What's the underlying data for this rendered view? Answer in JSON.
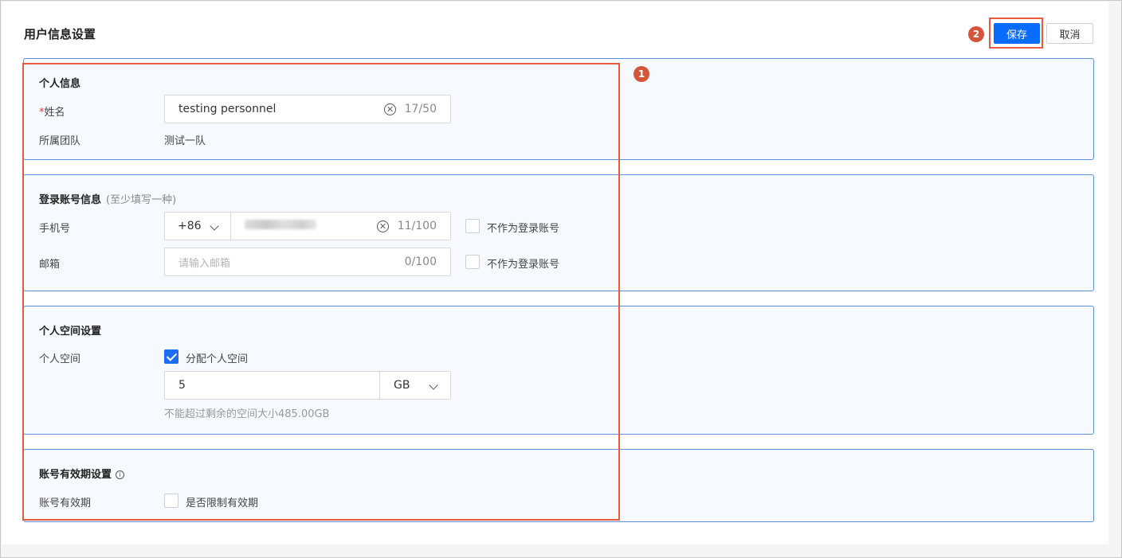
{
  "header": {
    "title": "用户信息设置",
    "save_label": "保存",
    "cancel_label": "取消"
  },
  "markers": {
    "form": "1",
    "save": "2"
  },
  "personal_info": {
    "title": "个人信息",
    "name_required_mark": "*",
    "name_label": "姓名",
    "name_value": "testing personnel",
    "name_counter": "17/50",
    "team_label": "所属团队",
    "team_value": "测试一队"
  },
  "login_info": {
    "title": "登录账号信息",
    "subtitle": "(至少填写一种)",
    "phone_label": "手机号",
    "country_code": "+86",
    "phone_counter": "11/100",
    "phone_not_login_label": "不作为登录账号",
    "email_label": "邮箱",
    "email_placeholder": "请输入邮箱",
    "email_counter": "0/100",
    "email_not_login_label": "不作为登录账号"
  },
  "space_settings": {
    "title": "个人空间设置",
    "label": "个人空间",
    "allocate_label": "分配个人空间",
    "allocate_checked": true,
    "size_value": "5",
    "unit": "GB",
    "hint": "不能超过剩余的空间大小485.00GB"
  },
  "expiry_settings": {
    "title": "账号有效期设置",
    "info_icon": "i",
    "label": "账号有效期",
    "limit_label": "是否限制有效期",
    "limit_checked": false
  },
  "colors": {
    "primary": "#0a6cff",
    "highlight": "#e85a3f",
    "section_border": "#5b8fd8",
    "section_bg": "#f6f9fd"
  }
}
